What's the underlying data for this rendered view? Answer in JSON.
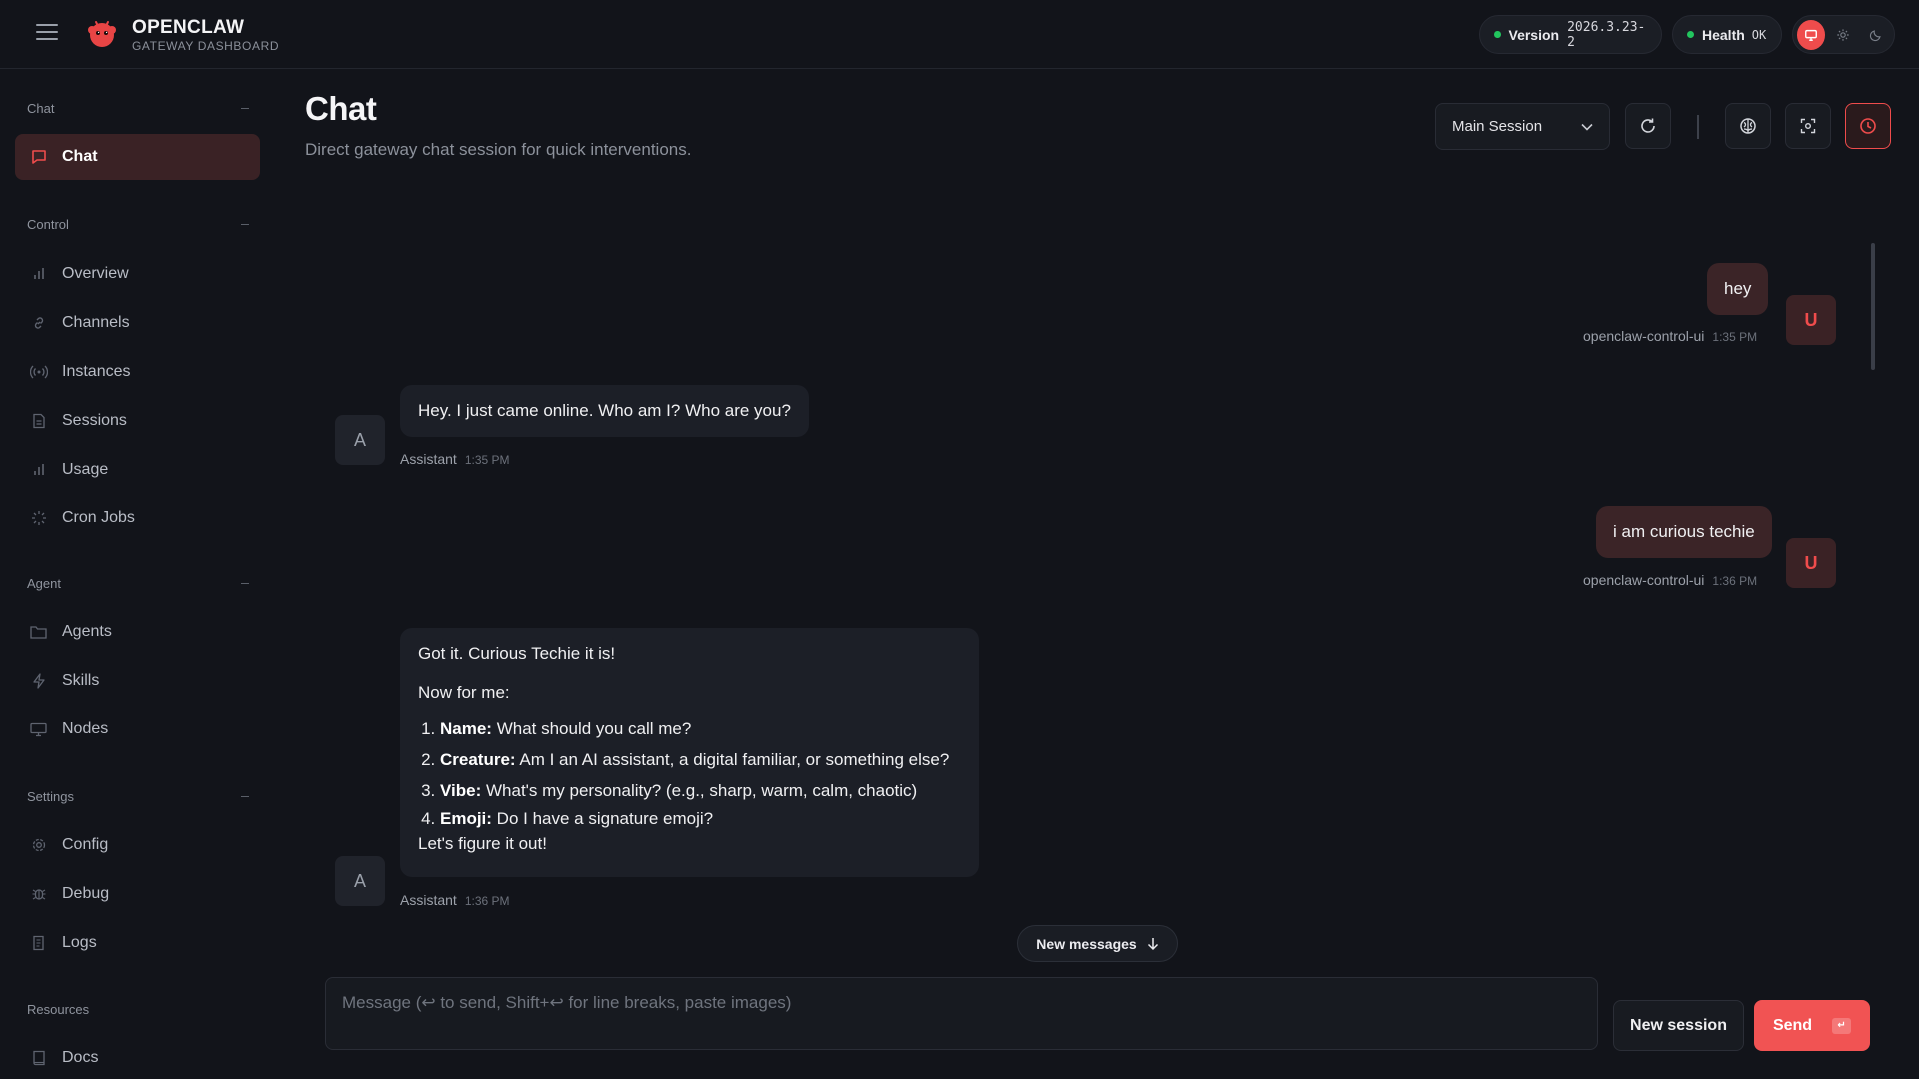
{
  "brand": {
    "title": "OPENCLAW",
    "subtitle": "GATEWAY DASHBOARD"
  },
  "status": {
    "version_label": "Version",
    "version_value": "2026.3.23-2",
    "health_label": "Health",
    "health_value": "OK",
    "status_color": "#22c55e"
  },
  "theme": {
    "options": [
      "monitor-icon",
      "sun-icon",
      "moon-icon"
    ],
    "active": "monitor-icon"
  },
  "sidebar": {
    "sections": {
      "chat": "Chat",
      "control": "Control",
      "agent": "Agent",
      "settings": "Settings",
      "resources": "Resources"
    },
    "items": {
      "chat": "Chat",
      "overview": "Overview",
      "channels": "Channels",
      "instances": "Instances",
      "sessions": "Sessions",
      "usage": "Usage",
      "cron_jobs": "Cron Jobs",
      "agents": "Agents",
      "skills": "Skills",
      "nodes": "Nodes",
      "config": "Config",
      "debug": "Debug",
      "logs": "Logs",
      "docs": "Docs"
    },
    "active": "chat"
  },
  "main": {
    "title": "Chat",
    "subtitle": "Direct gateway chat session for quick interventions.",
    "session_select": "Main Session"
  },
  "messages": [
    {
      "role": "user",
      "text": "hey",
      "sender": "openclaw-control-ui",
      "time": "1:35 PM",
      "avatar": "U"
    },
    {
      "role": "assistant",
      "text": "Hey. I just came online. Who am I? Who are you?",
      "sender": "Assistant",
      "time": "1:35 PM",
      "avatar": "A"
    },
    {
      "role": "user",
      "text": "i am curious techie",
      "sender": "openclaw-control-ui",
      "time": "1:36 PM",
      "avatar": "U"
    },
    {
      "role": "assistant",
      "intro": "Got it. Curious Techie it is!",
      "lead": "Now for me:",
      "list": [
        {
          "key": "Name:",
          "text": " What should you call me?"
        },
        {
          "key": "Creature:",
          "text": " Am I an AI assistant, a digital familiar, or something else?"
        },
        {
          "key": "Vibe:",
          "text": " What's my personality? (e.g., sharp, warm, calm, chaotic)"
        },
        {
          "key": "Emoji:",
          "text": " Do I have a signature emoji?"
        }
      ],
      "outro": "Let's figure it out!",
      "sender": "Assistant",
      "time": "1:36 PM",
      "avatar": "A"
    }
  ],
  "new_messages_label": "New messages",
  "composer": {
    "placeholder": "Message (↩ to send, Shift+↩ for line breaks, paste images)",
    "new_session_label": "New session",
    "send_label": "Send",
    "send_kbd": "↵"
  },
  "colors": {
    "accent": "#ef4c4c",
    "background": "#12141a",
    "user_bubble": "#3b2427",
    "assistant_bubble": "#1c1f27"
  }
}
